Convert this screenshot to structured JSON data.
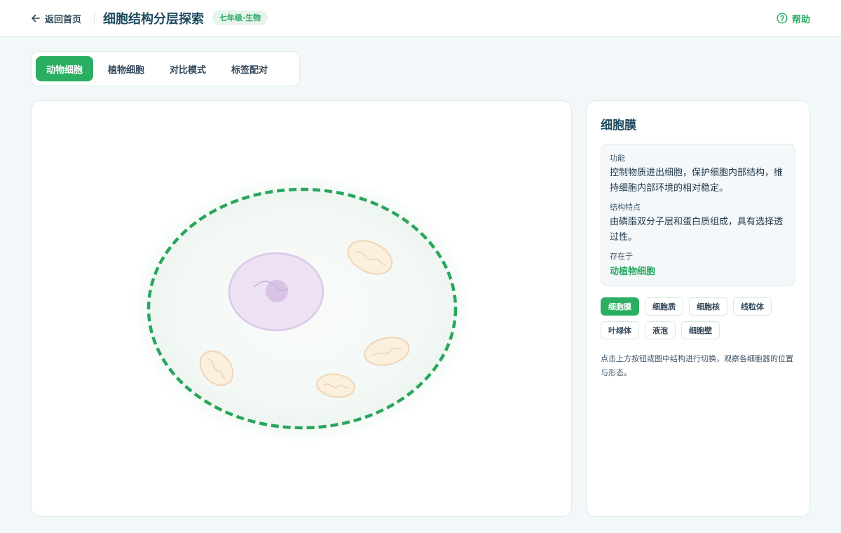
{
  "header": {
    "back_label": "返回首页",
    "title": "细胞结构分层探索",
    "badge": "七年级·生物",
    "help_label": "帮助"
  },
  "tabs": [
    {
      "label": "动物细胞",
      "active": true
    },
    {
      "label": "植物细胞",
      "active": false
    },
    {
      "label": "对比模式",
      "active": false
    },
    {
      "label": "标签配对",
      "active": false
    }
  ],
  "panel": {
    "title": "细胞膜",
    "function_label": "功能",
    "function_text": "控制物质进出细胞，保护细胞内部结构，维持细胞内部环境的相对稳定。",
    "structure_label": "结构特点",
    "structure_text": "由磷脂双分子层和蛋白质组成，具有选择透过性。",
    "exists_label": "存在于",
    "exists_text": "动植物细胞",
    "chips": [
      {
        "label": "细胞膜",
        "active": true
      },
      {
        "label": "细胞质",
        "active": false
      },
      {
        "label": "细胞核",
        "active": false
      },
      {
        "label": "线粒体",
        "active": false
      },
      {
        "label": "叶绿体",
        "active": false
      },
      {
        "label": "液泡",
        "active": false
      },
      {
        "label": "细胞壁",
        "active": false
      }
    ],
    "hint": "点击上方按钮或图中结构进行切换，观察各细胞器的位置与形态。"
  },
  "colors": {
    "accent": "#2aae62",
    "membrane": "#2aa65c",
    "nucleus": "#ece2f3",
    "nucleolus": "#d8c3e6",
    "mitochondria": "#fbefdd"
  },
  "icons": {
    "back": "arrow-left-icon",
    "help": "question-circle-icon"
  }
}
